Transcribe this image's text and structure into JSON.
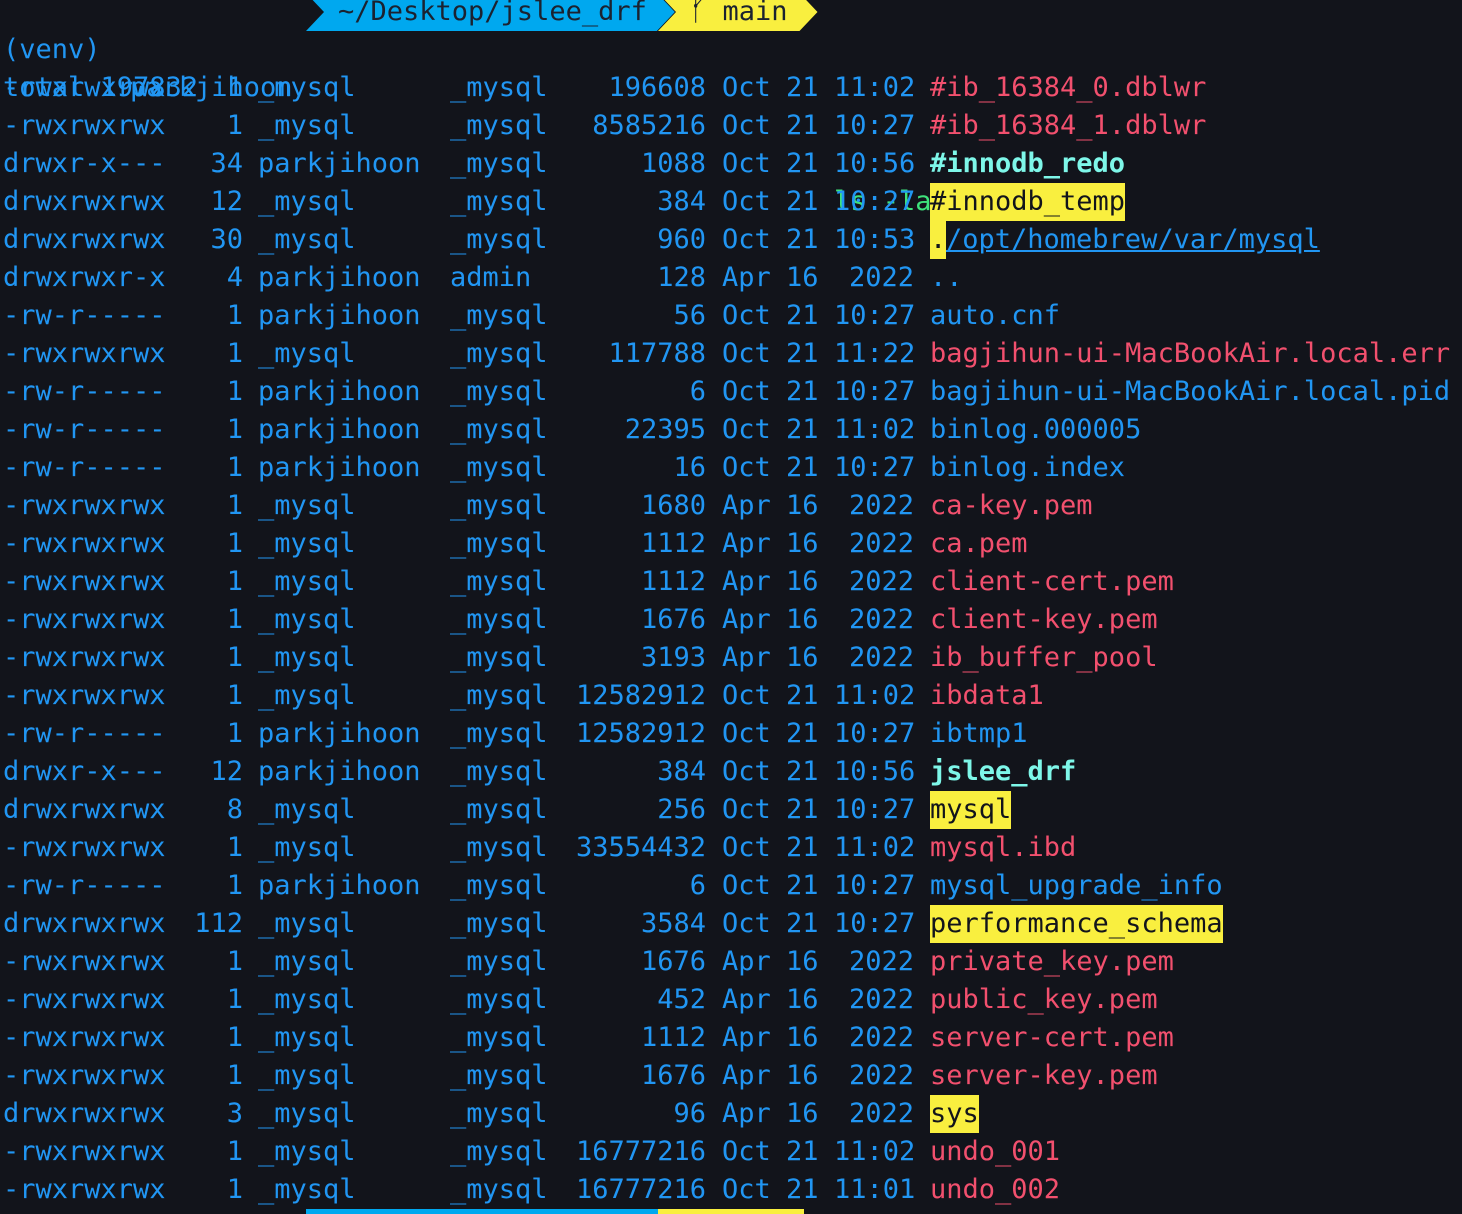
{
  "prompt": {
    "venv": "(venv)",
    "user": "parkjihoon",
    "path": "~/Desktop/jslee_drf",
    "branch_icon": "git-branch-icon",
    "branch": "main",
    "command": "ls -la",
    "argument": "/opt/homebrew/var/mysql"
  },
  "total": "total 197832",
  "colors": {
    "background": "#12141b",
    "blue": "#2196f3",
    "exec": "#f2506e",
    "dir": "#7ef7e9",
    "highlight": "#f9ef3f",
    "command": "#3ee27b"
  },
  "entries": [
    {
      "perm": "-rwxrwxrwx",
      "links": "1",
      "owner": "_mysql",
      "group": "_mysql",
      "size": "196608",
      "mon": "Oct",
      "day": "21",
      "time": "11:02",
      "name": "#ib_16384_0.dblwr",
      "type": "exec"
    },
    {
      "perm": "-rwxrwxrwx",
      "links": "1",
      "owner": "_mysql",
      "group": "_mysql",
      "size": "8585216",
      "mon": "Oct",
      "day": "21",
      "time": "10:27",
      "name": "#ib_16384_1.dblwr",
      "type": "exec"
    },
    {
      "perm": "drwxr-x---",
      "links": "34",
      "owner": "parkjihoon",
      "group": "_mysql",
      "size": "1088",
      "mon": "Oct",
      "day": "21",
      "time": "10:56",
      "name": "#innodb_redo",
      "type": "dir"
    },
    {
      "perm": "drwxrwxrwx",
      "links": "12",
      "owner": "_mysql",
      "group": "_mysql",
      "size": "384",
      "mon": "Oct",
      "day": "21",
      "time": "10:27",
      "name": "#innodb_temp",
      "type": "wdir"
    },
    {
      "perm": "drwxrwxrwx",
      "links": "30",
      "owner": "_mysql",
      "group": "_mysql",
      "size": "960",
      "mon": "Oct",
      "day": "21",
      "time": "10:53",
      "name": ".",
      "type": "wdir"
    },
    {
      "perm": "drwxrwxr-x",
      "links": "4",
      "owner": "parkjihoon",
      "group": "admin",
      "size": "128",
      "mon": "Apr",
      "day": "16",
      "time": "2022",
      "name": "..",
      "type": "parent"
    },
    {
      "perm": "-rw-r-----",
      "links": "1",
      "owner": "parkjihoon",
      "group": "_mysql",
      "size": "56",
      "mon": "Oct",
      "day": "21",
      "time": "10:27",
      "name": "auto.cnf",
      "type": "file"
    },
    {
      "perm": "-rwxrwxrwx",
      "links": "1",
      "owner": "_mysql",
      "group": "_mysql",
      "size": "117788",
      "mon": "Oct",
      "day": "21",
      "time": "11:22",
      "name": "bagjihun-ui-MacBookAir.local.err",
      "type": "exec"
    },
    {
      "perm": "-rw-r-----",
      "links": "1",
      "owner": "parkjihoon",
      "group": "_mysql",
      "size": "6",
      "mon": "Oct",
      "day": "21",
      "time": "10:27",
      "name": "bagjihun-ui-MacBookAir.local.pid",
      "type": "file"
    },
    {
      "perm": "-rw-r-----",
      "links": "1",
      "owner": "parkjihoon",
      "group": "_mysql",
      "size": "22395",
      "mon": "Oct",
      "day": "21",
      "time": "11:02",
      "name": "binlog.000005",
      "type": "file"
    },
    {
      "perm": "-rw-r-----",
      "links": "1",
      "owner": "parkjihoon",
      "group": "_mysql",
      "size": "16",
      "mon": "Oct",
      "day": "21",
      "time": "10:27",
      "name": "binlog.index",
      "type": "file"
    },
    {
      "perm": "-rwxrwxrwx",
      "links": "1",
      "owner": "_mysql",
      "group": "_mysql",
      "size": "1680",
      "mon": "Apr",
      "day": "16",
      "time": "2022",
      "name": "ca-key.pem",
      "type": "exec"
    },
    {
      "perm": "-rwxrwxrwx",
      "links": "1",
      "owner": "_mysql",
      "group": "_mysql",
      "size": "1112",
      "mon": "Apr",
      "day": "16",
      "time": "2022",
      "name": "ca.pem",
      "type": "exec"
    },
    {
      "perm": "-rwxrwxrwx",
      "links": "1",
      "owner": "_mysql",
      "group": "_mysql",
      "size": "1112",
      "mon": "Apr",
      "day": "16",
      "time": "2022",
      "name": "client-cert.pem",
      "type": "exec"
    },
    {
      "perm": "-rwxrwxrwx",
      "links": "1",
      "owner": "_mysql",
      "group": "_mysql",
      "size": "1676",
      "mon": "Apr",
      "day": "16",
      "time": "2022",
      "name": "client-key.pem",
      "type": "exec"
    },
    {
      "perm": "-rwxrwxrwx",
      "links": "1",
      "owner": "_mysql",
      "group": "_mysql",
      "size": "3193",
      "mon": "Apr",
      "day": "16",
      "time": "2022",
      "name": "ib_buffer_pool",
      "type": "exec"
    },
    {
      "perm": "-rwxrwxrwx",
      "links": "1",
      "owner": "_mysql",
      "group": "_mysql",
      "size": "12582912",
      "mon": "Oct",
      "day": "21",
      "time": "11:02",
      "name": "ibdata1",
      "type": "exec"
    },
    {
      "perm": "-rw-r-----",
      "links": "1",
      "owner": "parkjihoon",
      "group": "_mysql",
      "size": "12582912",
      "mon": "Oct",
      "day": "21",
      "time": "10:27",
      "name": "ibtmp1",
      "type": "file"
    },
    {
      "perm": "drwxr-x---",
      "links": "12",
      "owner": "parkjihoon",
      "group": "_mysql",
      "size": "384",
      "mon": "Oct",
      "day": "21",
      "time": "10:56",
      "name": "jslee_drf",
      "type": "dir"
    },
    {
      "perm": "drwxrwxrwx",
      "links": "8",
      "owner": "_mysql",
      "group": "_mysql",
      "size": "256",
      "mon": "Oct",
      "day": "21",
      "time": "10:27",
      "name": "mysql",
      "type": "wdir"
    },
    {
      "perm": "-rwxrwxrwx",
      "links": "1",
      "owner": "_mysql",
      "group": "_mysql",
      "size": "33554432",
      "mon": "Oct",
      "day": "21",
      "time": "11:02",
      "name": "mysql.ibd",
      "type": "exec"
    },
    {
      "perm": "-rw-r-----",
      "links": "1",
      "owner": "parkjihoon",
      "group": "_mysql",
      "size": "6",
      "mon": "Oct",
      "day": "21",
      "time": "10:27",
      "name": "mysql_upgrade_info",
      "type": "file"
    },
    {
      "perm": "drwxrwxrwx",
      "links": "112",
      "owner": "_mysql",
      "group": "_mysql",
      "size": "3584",
      "mon": "Oct",
      "day": "21",
      "time": "10:27",
      "name": "performance_schema",
      "type": "wdir"
    },
    {
      "perm": "-rwxrwxrwx",
      "links": "1",
      "owner": "_mysql",
      "group": "_mysql",
      "size": "1676",
      "mon": "Apr",
      "day": "16",
      "time": "2022",
      "name": "private_key.pem",
      "type": "exec"
    },
    {
      "perm": "-rwxrwxrwx",
      "links": "1",
      "owner": "_mysql",
      "group": "_mysql",
      "size": "452",
      "mon": "Apr",
      "day": "16",
      "time": "2022",
      "name": "public_key.pem",
      "type": "exec"
    },
    {
      "perm": "-rwxrwxrwx",
      "links": "1",
      "owner": "_mysql",
      "group": "_mysql",
      "size": "1112",
      "mon": "Apr",
      "day": "16",
      "time": "2022",
      "name": "server-cert.pem",
      "type": "exec"
    },
    {
      "perm": "-rwxrwxrwx",
      "links": "1",
      "owner": "_mysql",
      "group": "_mysql",
      "size": "1676",
      "mon": "Apr",
      "day": "16",
      "time": "2022",
      "name": "server-key.pem",
      "type": "exec"
    },
    {
      "perm": "drwxrwxrwx",
      "links": "3",
      "owner": "_mysql",
      "group": "_mysql",
      "size": "96",
      "mon": "Apr",
      "day": "16",
      "time": "2022",
      "name": "sys",
      "type": "wdir"
    },
    {
      "perm": "-rwxrwxrwx",
      "links": "1",
      "owner": "_mysql",
      "group": "_mysql",
      "size": "16777216",
      "mon": "Oct",
      "day": "21",
      "time": "11:02",
      "name": "undo_001",
      "type": "exec"
    },
    {
      "perm": "-rwxrwxrwx",
      "links": "1",
      "owner": "_mysql",
      "group": "_mysql",
      "size": "16777216",
      "mon": "Oct",
      "day": "21",
      "time": "11:01",
      "name": "undo_002",
      "type": "exec"
    }
  ]
}
